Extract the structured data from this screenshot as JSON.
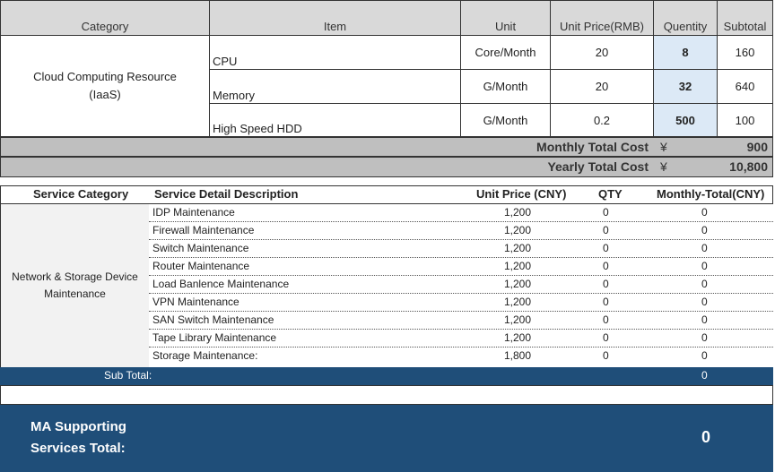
{
  "iaas": {
    "headers": {
      "category": "Category",
      "item": "Item",
      "unit": "Unit",
      "unit_price": "Unit Price(RMB)",
      "quantity": "Quentity",
      "subtotal": "Subtotal"
    },
    "category": "Cloud Computing Resource (IaaS)",
    "rows": [
      {
        "item": "CPU",
        "unit": "Core/Month",
        "price": "20",
        "qty": "8",
        "subtotal": "160"
      },
      {
        "item": "Memory",
        "unit": "G/Month",
        "price": "20",
        "qty": "32",
        "subtotal": "640"
      },
      {
        "item": "High Speed HDD",
        "unit": "G/Month",
        "price": "0.2",
        "qty": "500",
        "subtotal": "100"
      }
    ],
    "monthly": {
      "label": "Monthly Total Cost",
      "currency": "¥",
      "value": "900"
    },
    "yearly": {
      "label": "Yearly Total Cost",
      "currency": "¥",
      "value": "10,800"
    }
  },
  "maintenance": {
    "headers": {
      "category": "Service Category",
      "description": "Service Detail Description",
      "unit_price": "Unit Price (CNY)",
      "qty": "QTY",
      "monthly_total": "Monthly-Total(CNY)"
    },
    "category": "Network & Storage Device Maintenance",
    "rows": [
      {
        "desc": "IDP Maintenance",
        "price": "1,200",
        "qty": "0",
        "total": "0"
      },
      {
        "desc": "Firewall Maintenance",
        "price": "1,200",
        "qty": "0",
        "total": "0"
      },
      {
        "desc": "Switch Maintenance",
        "price": "1,200",
        "qty": "0",
        "total": "0"
      },
      {
        "desc": "Router Maintenance",
        "price": "1,200",
        "qty": "0",
        "total": "0"
      },
      {
        "desc": "Load Banlence Maintenance",
        "price": "1,200",
        "qty": "0",
        "total": "0"
      },
      {
        "desc": "VPN Maintenance",
        "price": "1,200",
        "qty": "0",
        "total": "0"
      },
      {
        "desc": "SAN Switch Maintenance",
        "price": "1,200",
        "qty": "0",
        "total": "0"
      },
      {
        "desc": "Tape Library Maintenance",
        "price": "1,200",
        "qty": "0",
        "total": "0"
      },
      {
        "desc": "Storage Maintenance:",
        "price": "1,800",
        "qty": "0",
        "total": "0"
      }
    ],
    "subtotal": {
      "label": "Sub Total:",
      "value": "0"
    }
  },
  "ma_total": {
    "label": "MA Supporting Services Total:",
    "value": "0"
  },
  "colors": {
    "header_gray": "#d9d9d9",
    "total_gray": "#bfbfbf",
    "qty_highlight": "#dce9f6",
    "navy": "#1f4e79",
    "category_bg": "#f2f2f2"
  }
}
